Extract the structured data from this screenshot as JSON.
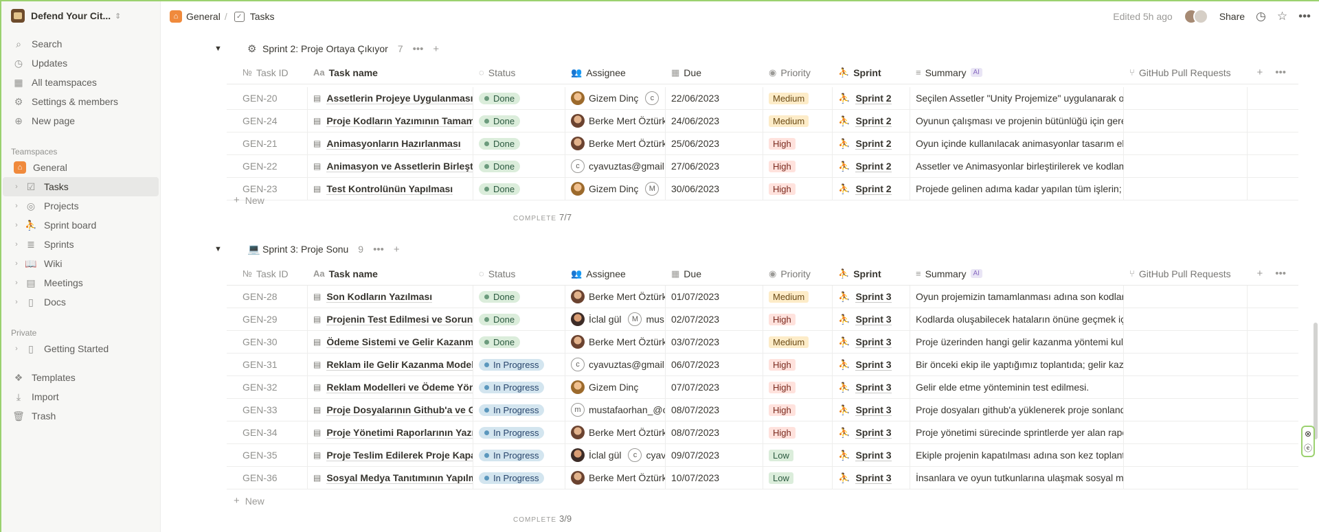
{
  "sidebar": {
    "workspace": "Defend Your Cit...",
    "nav": [
      {
        "icon": "search-icon",
        "glyph": "⌕",
        "label": "Search"
      },
      {
        "icon": "updates-icon",
        "glyph": "◷",
        "label": "Updates"
      },
      {
        "icon": "teamspaces-icon",
        "glyph": "▦",
        "label": "All teamspaces"
      },
      {
        "icon": "gear-icon",
        "glyph": "⚙",
        "label": "Settings & members"
      },
      {
        "icon": "new-page-icon",
        "glyph": "⊕",
        "label": "New page"
      }
    ],
    "teamspaces_label": "Teamspaces",
    "general_label": "General",
    "teamspace_items": [
      {
        "icon": "checkbox-icon",
        "glyph": "☑",
        "label": "Tasks",
        "active": true
      },
      {
        "icon": "target-icon",
        "glyph": "◎",
        "label": "Projects"
      },
      {
        "icon": "runner-icon",
        "glyph": "⛹",
        "label": "Sprint board"
      },
      {
        "icon": "database-icon",
        "glyph": "≣",
        "label": "Sprints"
      },
      {
        "icon": "book-icon",
        "glyph": "📖",
        "label": "Wiki"
      },
      {
        "icon": "meetings-icon",
        "glyph": "▤",
        "label": "Meetings"
      },
      {
        "icon": "doc-icon",
        "glyph": "▯",
        "label": "Docs"
      }
    ],
    "private_label": "Private",
    "private_items": [
      {
        "icon": "doc-icon",
        "glyph": "▯",
        "label": "Getting Started"
      }
    ],
    "bottom": [
      {
        "icon": "templates-icon",
        "glyph": "❖",
        "label": "Templates"
      },
      {
        "icon": "import-icon",
        "glyph": "⤓",
        "label": "Import"
      },
      {
        "icon": "trash-icon",
        "glyph": "🗑",
        "label": "Trash"
      }
    ]
  },
  "topbar": {
    "crumb_general": "General",
    "crumb_sep": "/",
    "crumb_tasks": "Tasks",
    "edited": "Edited 5h ago",
    "share": "Share"
  },
  "table_headers": [
    {
      "icon": "№",
      "label": "Task ID"
    },
    {
      "icon": "Aa",
      "label": "Task name"
    },
    {
      "icon": "◌",
      "label": "Status"
    },
    {
      "icon": "👥",
      "label": "Assignee"
    },
    {
      "icon": "▦",
      "label": "Due"
    },
    {
      "icon": "◉",
      "label": "Priority"
    },
    {
      "icon": "⛹",
      "label": "Sprint"
    },
    {
      "icon": "≡",
      "label": "Summary",
      "ai": "AI"
    },
    {
      "icon": "⑂",
      "label": "GitHub Pull Requests"
    }
  ],
  "groups": [
    {
      "icon": "⚙",
      "title": "Sprint 2: Proje Ortaya Çıkıyor",
      "count": "7",
      "complete_label": "COMPLETE",
      "complete_value": "7/7",
      "new_label": "New",
      "rows": [
        {
          "id": "GEN-20",
          "name": "Assetlerin Projeye Uygulanması",
          "status": "Done",
          "assignee": "Gizem Dinç",
          "assignee2": "c",
          "due": "22/06/2023",
          "priority": "Medium",
          "sprint": "Sprint 2",
          "summary": "Seçilen Assetler \"Unity Projemize\" uygulanarak oy"
        },
        {
          "id": "GEN-24",
          "name": "Proje Kodların Yazımının Tamamlanması",
          "status": "Done",
          "assignee": "Berke Mert Öztürk",
          "due": "24/06/2023",
          "priority": "Medium",
          "sprint": "Sprint 2",
          "summary": "Oyunun çalışması ve projenin bütünlüğü için gere"
        },
        {
          "id": "GEN-21",
          "name": "Animasyonların Hazırlanması",
          "status": "Done",
          "assignee": "Berke Mert Öztürk",
          "due": "25/06/2023",
          "priority": "High",
          "sprint": "Sprint 2",
          "summary": "Oyun içinde kullanılacak animasyonlar tasarım eki"
        },
        {
          "id": "GEN-22",
          "name": "Animasyon ve Assetlerin Birleştirilmesi",
          "status": "Done",
          "assignee": "cyavuztas@gmail.com",
          "due": "27/06/2023",
          "priority": "High",
          "sprint": "Sprint 2",
          "summary": "Assetler ve Animasyonlar birleştirilerek ve kodlam"
        },
        {
          "id": "GEN-23",
          "name": "Test Kontrolünün Yapılması",
          "status": "Done",
          "assignee": "Gizem Dinç",
          "assignee2": "M",
          "due": "30/06/2023",
          "priority": "High",
          "sprint": "Sprint 2",
          "summary": "Projede gelinen adıma kadar yapılan tüm işlerin; y"
        }
      ]
    },
    {
      "icon": "💻",
      "title": "Sprint 3: Proje Sonu",
      "count": "9",
      "complete_label": "COMPLETE",
      "complete_value": "3/9",
      "new_label": "New",
      "rows": [
        {
          "id": "GEN-28",
          "name": "Son Kodların Yazılması",
          "status": "Done",
          "assignee": "Berke Mert Öztürk",
          "due": "01/07/2023",
          "priority": "Medium",
          "sprint": "Sprint 3",
          "summary": "Oyun projemizin tamamlanması adına son kodlar"
        },
        {
          "id": "GEN-29",
          "name": "Projenin Test Edilmesi ve Sorunların Giderilmesi",
          "status": "Done",
          "assignee": "İclal gül",
          "assignee2": "M",
          "assignee2_text": "mus",
          "due": "02/07/2023",
          "priority": "High",
          "sprint": "Sprint 3",
          "summary": "Kodlarda oluşabilecek hataların önüne geçmek içi"
        },
        {
          "id": "GEN-30",
          "name": "Ödeme Sistemi ve Gelir Kazanma Yöntemi",
          "status": "Done",
          "assignee": "Berke Mert Öztürk",
          "due": "03/07/2023",
          "priority": "Medium",
          "sprint": "Sprint 3",
          "summary": "Proje üzerinden hangi gelir kazanma yöntemi kull"
        },
        {
          "id": "GEN-31",
          "name": "Reklam ile Gelir Kazanma Modeli",
          "status": "In Progress",
          "assignee": "cyavuztas@gmail.com",
          "due": "06/07/2023",
          "priority": "High",
          "sprint": "Sprint 3",
          "summary": "Bir önceki ekip ile yaptığımız toplantıda; gelir kaza"
        },
        {
          "id": "GEN-32",
          "name": "Reklam Modelleri ve Ödeme Yöntemleri",
          "status": "In Progress",
          "assignee": "Gizem Dinç",
          "due": "07/07/2023",
          "priority": "High",
          "sprint": "Sprint 3",
          "summary": "Gelir elde etme yönteminin test edilmesi."
        },
        {
          "id": "GEN-33",
          "name": "Proje Dosyalarının Github'a ve Google Drive'a",
          "status": "In Progress",
          "assignee": "mustafaorhan_@outlook.com",
          "due": "08/07/2023",
          "priority": "High",
          "sprint": "Sprint 3",
          "summary": "Proje dosyaları github'a yüklenerek proje sonland"
        },
        {
          "id": "GEN-34",
          "name": "Proje Yönetimi Raporlarının Yazılması",
          "status": "In Progress",
          "assignee": "Berke Mert Öztürk",
          "due": "08/07/2023",
          "priority": "High",
          "sprint": "Sprint 3",
          "summary": "Proje yönetimi sürecinde sprintlerde yer alan rapo"
        },
        {
          "id": "GEN-35",
          "name": "Proje Teslim Edilerek Proje Kapatılması",
          "status": "In Progress",
          "assignee": "İclal gül",
          "assignee2": "c",
          "assignee2_text": "cyav",
          "due": "09/07/2023",
          "priority": "Low",
          "sprint": "Sprint 3",
          "summary": "Ekiple projenin kapatılması adına son kez toplantı"
        },
        {
          "id": "GEN-36",
          "name": "Sosyal Medya Tanıtımının Yapılması",
          "status": "In Progress",
          "assignee": "Berke Mert Öztürk",
          "due": "10/07/2023",
          "priority": "Low",
          "sprint": "Sprint 3",
          "summary": "İnsanlara ve oyun tutkunlarına ulaşmak sosyal me"
        }
      ]
    }
  ]
}
